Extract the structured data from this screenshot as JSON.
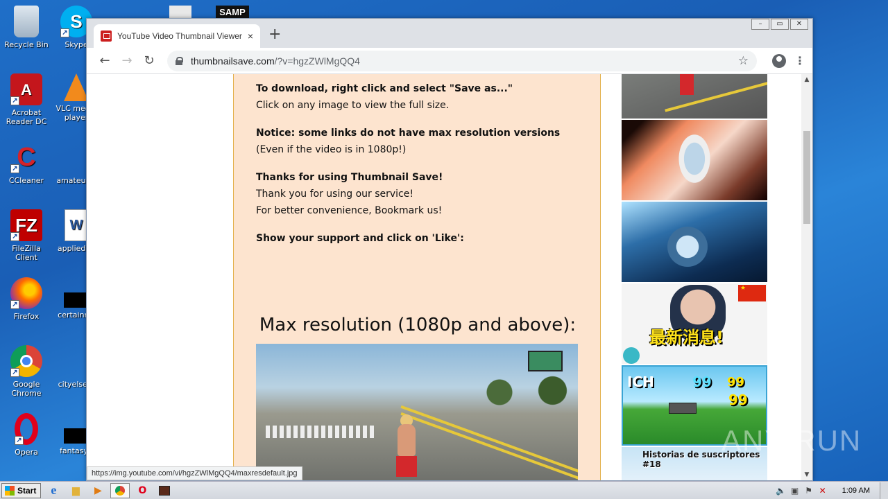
{
  "desktop": {
    "icons": [
      {
        "label": "Recycle Bin"
      },
      {
        "label": "Skype"
      },
      {
        "label": "Acrobat Reader DC"
      },
      {
        "label": "VLC media player"
      },
      {
        "label": "CCleaner"
      },
      {
        "label": "amateurm"
      },
      {
        "label": "FileZilla Client"
      },
      {
        "label": "appliedag"
      },
      {
        "label": "Firefox"
      },
      {
        "label": "certainmr"
      },
      {
        "label": "Google Chrome"
      },
      {
        "label": "cityelse..."
      },
      {
        "label": "Opera"
      },
      {
        "label": "fantasyu"
      },
      {
        "label": "SAMP"
      }
    ]
  },
  "browser": {
    "tab_title": "YouTube Video Thumbnail Viewer and",
    "tab_close": "×",
    "new_tab": "+",
    "url_host": "thumbnailsave.com",
    "url_path": "/?v=hgzZWlMgQQ4",
    "status_url": "https://img.youtube.com/vi/hgzZWlMgQQ4/maxresdefault.jpg"
  },
  "content": {
    "line1_bold": "To download, right click and select \"Save as...\"",
    "line2": "Click on any image to view the full size.",
    "notice_bold": "Notice: some links do not have max resolution versions",
    "notice_sub": "(Even if the video is in 1080p!)",
    "thanks_bold": "Thanks for using Thumbnail Save!",
    "thanks1": "Thank you for using our service!",
    "thanks2": "For better convenience, Bookmark us!",
    "support_bold": "Show your support and click on 'Like':",
    "maxres_heading": "Max resolution (1080p and above):"
  },
  "sidebar_thumbs": {
    "headline_cn": "最新消息!",
    "ich": "ICH",
    "n1": "99",
    "n2": "99",
    "n3": "99",
    "historias": "Historias de suscriptores #18"
  },
  "watermark": "ANY RUN",
  "taskbar": {
    "start_label": "Start",
    "clock": "1:09 AM"
  }
}
